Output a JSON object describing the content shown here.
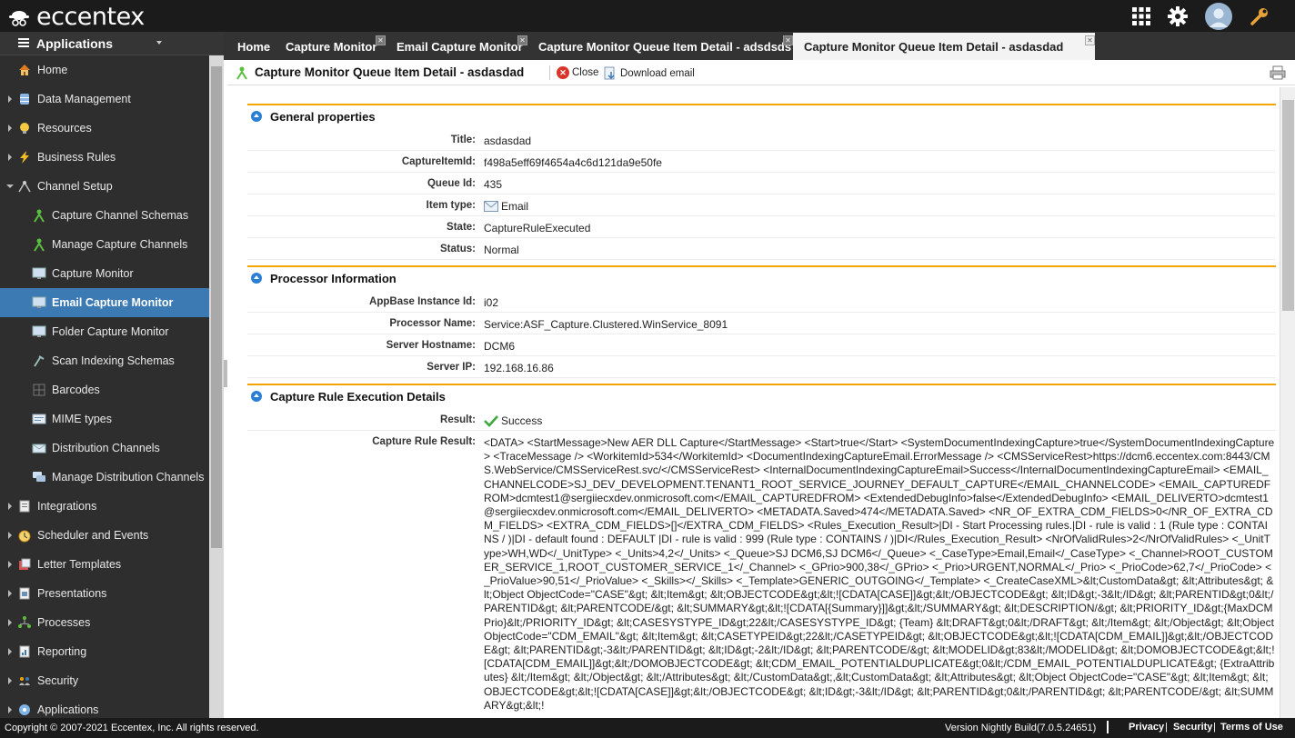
{
  "app": {
    "logo_text": "eccentex"
  },
  "sidebar": {
    "header": "Applications",
    "items": [
      {
        "label": "Home",
        "icon": "home-icon"
      },
      {
        "label": "Data Management",
        "icon": "database-icon"
      },
      {
        "label": "Resources",
        "icon": "lightbulb-icon"
      },
      {
        "label": "Business Rules",
        "icon": "lightning-icon"
      },
      {
        "label": "Channel Setup",
        "icon": "channel-icon"
      },
      {
        "label": "Capture Channel Schemas",
        "icon": "capture-icon"
      },
      {
        "label": "Manage Capture Channels",
        "icon": "capture-icon"
      },
      {
        "label": "Capture Monitor",
        "icon": "monitor-icon"
      },
      {
        "label": "Email Capture Monitor",
        "icon": "monitor-icon"
      },
      {
        "label": "Folder Capture Monitor",
        "icon": "monitor-icon"
      },
      {
        "label": "Scan Indexing Schemas",
        "icon": "scan-icon"
      },
      {
        "label": "Barcodes",
        "icon": "barcode-icon"
      },
      {
        "label": "MIME types",
        "icon": "mime-icon"
      },
      {
        "label": "Distribution Channels",
        "icon": "envelope-icon"
      },
      {
        "label": "Manage Distribution Channels",
        "icon": "chat-icon"
      },
      {
        "label": "Integrations",
        "icon": "integration-icon"
      },
      {
        "label": "Scheduler and Events",
        "icon": "scheduler-icon"
      },
      {
        "label": "Letter Templates",
        "icon": "letter-icon"
      },
      {
        "label": "Presentations",
        "icon": "presentation-icon"
      },
      {
        "label": "Processes",
        "icon": "process-icon"
      },
      {
        "label": "Reporting",
        "icon": "report-icon"
      },
      {
        "label": "Security",
        "icon": "security-icon"
      },
      {
        "label": "Applications",
        "icon": "applications-icon"
      }
    ]
  },
  "tabs": [
    {
      "label": "Home"
    },
    {
      "label": "Capture Monitor"
    },
    {
      "label": "Email Capture Monitor"
    },
    {
      "label": "Capture Monitor Queue Item Detail - adsdsds"
    },
    {
      "label": "Capture Monitor Queue Item Detail - asdasdad"
    }
  ],
  "toolbar": {
    "title": "Capture Monitor Queue Item Detail - asdasdad",
    "close_label": "Close",
    "download_label": "Download email"
  },
  "general": {
    "title": "General properties",
    "rows": [
      {
        "key": "Title:",
        "value": "asdasdad"
      },
      {
        "key": "CaptureItemId:",
        "value": "f498a5eff69f4654a4c6d121da9e50fe"
      },
      {
        "key": "Queue Id:",
        "value": "435"
      },
      {
        "key": "Item type:",
        "value": "Email"
      },
      {
        "key": "State:",
        "value": "CaptureRuleExecuted"
      },
      {
        "key": "Status:",
        "value": "Normal"
      }
    ]
  },
  "processor": {
    "title": "Processor Information",
    "rows": [
      {
        "key": "AppBase Instance Id:",
        "value": "i02"
      },
      {
        "key": "Processor Name:",
        "value": "Service:ASF_Capture.Clustered.WinService_8091"
      },
      {
        "key": "Server Hostname:",
        "value": "DCM6"
      },
      {
        "key": "Server IP:",
        "value": "192.168.16.86"
      }
    ]
  },
  "execution": {
    "title": "Capture Rule Execution Details",
    "result_key": "Result:",
    "result_value": "Success",
    "crr_key": "Capture Rule Result:",
    "crr_value": "<DATA> <StartMessage>New AER DLL Capture</StartMessage> <Start>true</Start> <SystemDocumentIndexingCapture>true</SystemDocumentIndexingCapture> <TraceMessage /> <WorkitemId>534</WorkitemId> <DocumentIndexingCaptureEmail.ErrorMessage /> <CMSServiceRest>https://dcm6.eccentex.com:8443/CMS.WebService/CMSServiceRest.svc/</CMSServiceRest> <InternalDocumentIndexingCaptureEmail>Success</InternalDocumentIndexingCaptureEmail> <EMAIL_CHANNELCODE>SJ_DEV_DEVELOPMENT.TENANT1_ROOT_SERVICE_JOURNEY_DEFAULT_CAPTURE</EMAIL_CHANNELCODE> <EMAIL_CAPTUREDFROM>dcmtest1@sergiiecxdev.onmicrosoft.com</EMAIL_CAPTUREDFROM> <ExtendedDebugInfo>false</ExtendedDebugInfo> <EMAIL_DELIVERTO>dcmtest1@sergiiecxdev.onmicrosoft.com</EMAIL_DELIVERTO> <METADATA.Saved>474</METADATA.Saved> <NR_OF_EXTRA_CDM_FIELDS>0</NR_OF_EXTRA_CDM_FIELDS> <EXTRA_CDM_FIELDS>[]</EXTRA_CDM_FIELDS> <Rules_Execution_Result>|DI - Start Processing rules.|DI - rule is valid : 1 (Rule type : CONTAINS / )|DI - default found : DEFAULT |DI - rule is valid : 999 (Rule type : CONTAINS / )|DI</Rules_Execution_Result> <NrOfValidRules>2</NrOfValidRules> <_UnitType>WH,WD</_UnitType> <_Units>4,2</_Units> <_Queue>SJ DCM6,SJ DCM6</_Queue> <_CaseType>Email,Email</_CaseType> <_Channel>ROOT_CUSTOMER_SERVICE_1,ROOT_CUSTOMER_SERVICE_1</_Channel> <_GPrio>900,38</_GPrio> <_Prio>URGENT,NORMAL</_Prio> <_PrioCode>62,7</_PrioCode> <_PrioValue>90,51</_PrioValue> <_Skills></_Skills> <_Template>GENERIC_OUTGOING</_Template> <_CreateCaseXML>&lt;CustomData&gt; &lt;Attributes&gt; &lt;Object ObjectCode=\"CASE\"&gt; &lt;Item&gt; &lt;OBJECTCODE&gt;&lt;![CDATA[CASE]]&gt;&lt;/OBJECTCODE&gt; &lt;ID&gt;-3&lt;/ID&gt; &lt;PARENTID&gt;0&lt;/PARENTID&gt; &lt;PARENTCODE/&gt; &lt;SUMMARY&gt;&lt;![CDATA[{Summary}]]&gt;&lt;/SUMMARY&gt; &lt;DESCRIPTION/&gt; &lt;PRIORITY_ID&gt;{MaxDCMPrio}&lt;/PRIORITY_ID&gt; &lt;CASESYSTYPE_ID&gt;22&lt;/CASESYSTYPE_ID&gt; {Team} &lt;DRAFT&gt;0&lt;/DRAFT&gt; &lt;/Item&gt; &lt;/Object&gt; &lt;Object ObjectCode=\"CDM_EMAIL\"&gt; &lt;Item&gt; &lt;CASETYPEID&gt;22&lt;/CASETYPEID&gt; &lt;OBJECTCODE&gt;&lt;![CDATA[CDM_EMAIL]]&gt;&lt;/OBJECTCODE&gt; &lt;PARENTID&gt;-3&lt;/PARENTID&gt; &lt;ID&gt;-2&lt;/ID&gt; &lt;PARENTCODE/&gt; &lt;MODELID&gt;83&lt;/MODELID&gt; &lt;DOMOBJECTCODE&gt;&lt;![CDATA[CDM_EMAIL]]&gt;&lt;/DOMOBJECTCODE&gt; &lt;CDM_EMAIL_POTENTIALDUPLICATE&gt;0&lt;/CDM_EMAIL_POTENTIALDUPLICATE&gt; {ExtraAttributes} &lt;/Item&gt; &lt;/Object&gt; &lt;/Attributes&gt; &lt;/CustomData&gt;,&lt;CustomData&gt; &lt;Attributes&gt; &lt;Object ObjectCode=\"CASE\"&gt; &lt;Item&gt; &lt;OBJECTCODE&gt;&lt;![CDATA[CASE]]&gt;&lt;/OBJECTCODE&gt; &lt;ID&gt;-3&lt;/ID&gt; &lt;PARENTID&gt;0&lt;/PARENTID&gt; &lt;PARENTCODE/&gt; &lt;SUMMARY&gt;&lt;!"
  },
  "footer": {
    "copyright": "Copyright © 2007-2021 Eccentex, Inc. All rights reserved.",
    "version": "Version  Nightly Build(7.0.5.24651)",
    "privacy": "Privacy",
    "security": "Security",
    "terms": "Terms of Use"
  },
  "colors": {
    "accent": "#f0a500",
    "active": "#3b7ab3",
    "topbar": "#1b1b1b",
    "sidebar": "#2e2e2e"
  }
}
